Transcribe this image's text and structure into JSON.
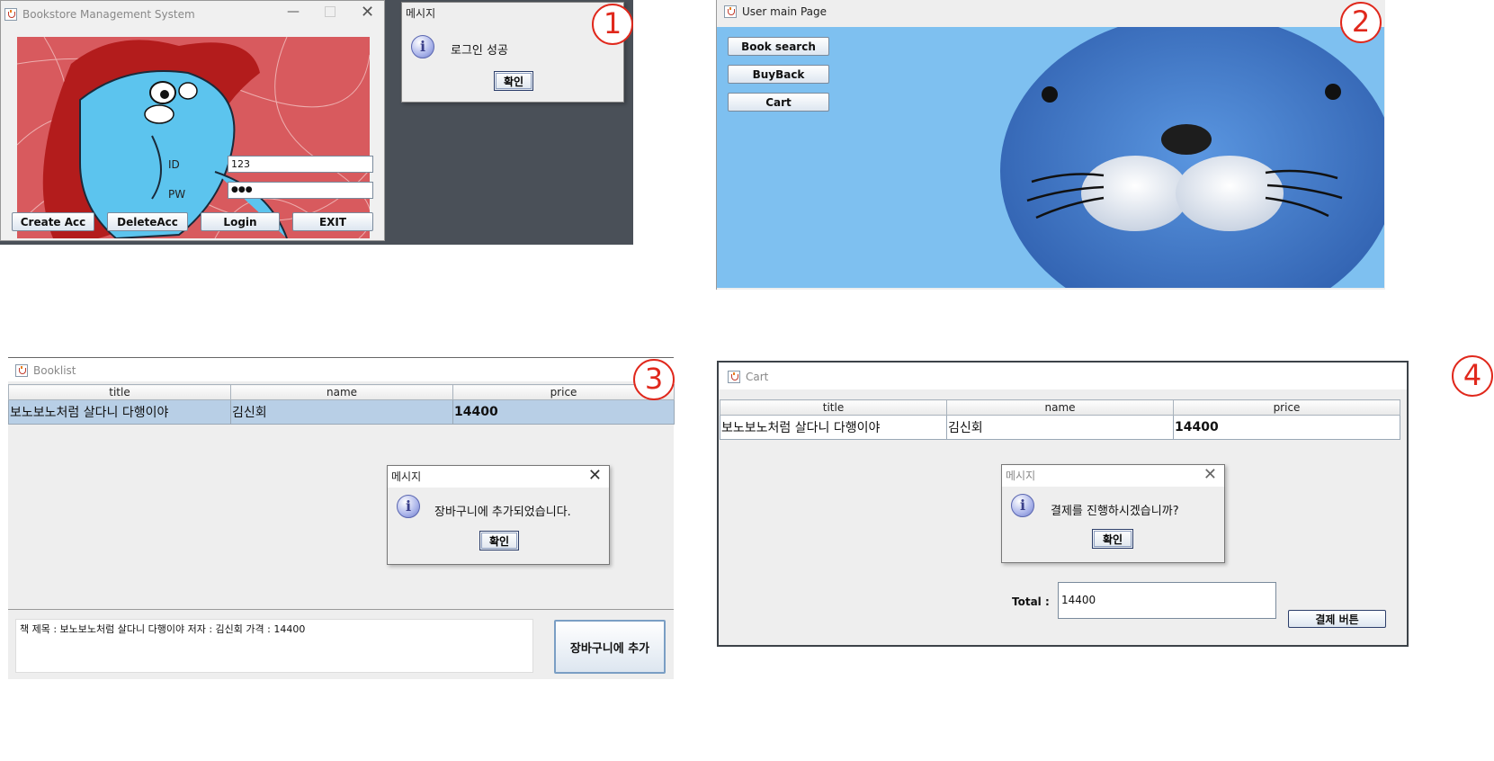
{
  "panel1": {
    "badge": "1",
    "window_title": "Bookstore Management System",
    "id_label": "ID",
    "pw_label": "PW",
    "id_value": "123",
    "pw_value": "●●●",
    "buttons": {
      "create": "Create Acc",
      "delete": "DeleteAcc",
      "login": "Login",
      "exit": "EXIT"
    },
    "dialog": {
      "title": "메시지",
      "message": "로그인 성공",
      "ok": "확인"
    }
  },
  "panel2": {
    "badge": "2",
    "window_title": "User main Page",
    "buttons": {
      "search": "Book search",
      "buyback": "BuyBack",
      "cart": "Cart"
    }
  },
  "panel3": {
    "badge": "3",
    "window_title": "Booklist",
    "columns": [
      "title",
      "name",
      "price"
    ],
    "row": {
      "title": "보노보노처럼 살다니 다행이야",
      "name": "김신회",
      "price": "14400"
    },
    "dialog": {
      "title": "메시지",
      "message": "장바구니에 추가되었습니다.",
      "ok": "확인"
    },
    "detail_text": "책 제목 : 보노보노처럼 살다니 다행이야  저자 : 김신회  가격 : 14400",
    "add_button": "장바구니에 추가"
  },
  "panel4": {
    "badge": "4",
    "window_title": "Cart",
    "columns": [
      "title",
      "name",
      "price"
    ],
    "row": {
      "title": "보노보노처럼 살다니 다행이야",
      "name": "김신회",
      "price": "14400"
    },
    "dialog": {
      "title": "메시지",
      "message": "결제를 진행하시겠습니까?",
      "ok": "확인"
    },
    "total_label": "Total :",
    "total_value": "14400",
    "pay_button": "결제 버튼"
  },
  "colors": {
    "badge_red": "#e0281c",
    "java_gray": "#eeeeee",
    "sky_blue": "#7ec0f0",
    "selection_blue": "#b8cfe6"
  }
}
